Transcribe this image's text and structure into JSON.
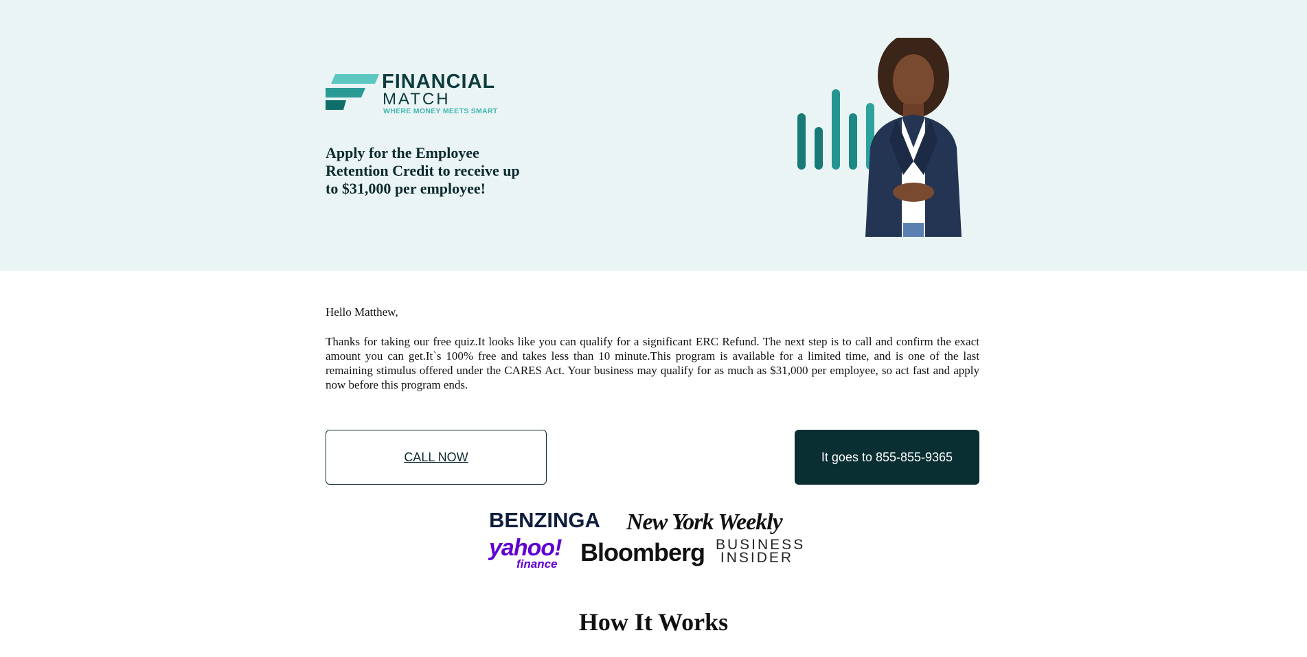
{
  "brand": {
    "name_line1": "FINANCIAL",
    "name_line2": "MATCH",
    "tagline": "WHERE MONEY MEETS SMART",
    "colors": {
      "dark": "#0d3b3e",
      "teal": "#3db5b0",
      "teal_light": "#5cc6c0"
    }
  },
  "hero": {
    "headline": "Apply for the Employee Retention Credit to receive up to $31,000 per employee!",
    "background": "#eaf4f4"
  },
  "message": {
    "greeting": "Hello Matthew,",
    "body": "Thanks for taking our free quiz.It looks like you can qualify for a significant ERC Refund. The next step is to call and confirm the exact amount you can get.It`s 100% free and takes less than 10 minute.This program is available for a limited time, and is one of the last remaining stimulus offered under the CARES Act. Your business may qualify for as much as $31,000 per employee, so act fast and apply now before this program ends."
  },
  "actions": {
    "call_now": "CALL NOW",
    "phone": "It goes to 855-855-9365"
  },
  "press": {
    "benzinga": "BENZINGA",
    "new_york_weekly": "New York Weekly",
    "yahoo": "yahoo!",
    "yahoo_finance": "finance",
    "bloomberg": "Bloomberg",
    "business_insider_line1": "BUSINESS",
    "business_insider_line2": "INSIDER"
  },
  "sections": {
    "how_it_works": "How It Works"
  }
}
